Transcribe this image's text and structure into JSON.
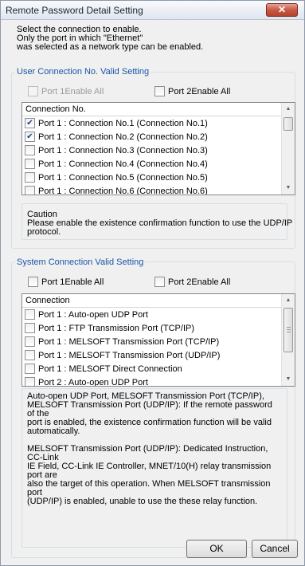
{
  "window": {
    "title": "Remote Password Detail Setting",
    "close_icon": "close-icon"
  },
  "intro": {
    "line1": "Select the connection to enable.",
    "line2": "Only the port in which \"Ethernet\"",
    "line3": "was selected as a network type can be enabled."
  },
  "user_group": {
    "legend": "User Connection No. Valid Setting",
    "port1_enable_all": "Port 1Enable All",
    "port1_enable_all_checked": false,
    "port1_enable_all_enabled": false,
    "port2_enable_all": "Port 2Enable All",
    "port2_enable_all_checked": false,
    "list_header": "Connection No.",
    "rows": [
      {
        "label": "Port 1 : Connection No.1 (Connection No.1)",
        "checked": true
      },
      {
        "label": "Port 1 : Connection No.2 (Connection No.2)",
        "checked": true
      },
      {
        "label": "Port 1 : Connection No.3 (Connection No.3)",
        "checked": false
      },
      {
        "label": "Port 1 : Connection No.4 (Connection No.4)",
        "checked": false
      },
      {
        "label": "Port 1 : Connection No.5 (Connection No.5)",
        "checked": false
      },
      {
        "label": "Port 1 : Connection No.6 (Connection No.6)",
        "checked": false
      }
    ],
    "caution_title": "Caution",
    "caution_line1": "Please enable the existence confirmation function to use the UDP/IP",
    "caution_line2": "protocol."
  },
  "system_group": {
    "legend": "System Connection Valid Setting",
    "port1_enable_all": "Port 1Enable All",
    "port1_enable_all_checked": false,
    "port2_enable_all": "Port 2Enable All",
    "port2_enable_all_checked": false,
    "list_header": "Connection",
    "rows": [
      {
        "label": "Port 1 : Auto-open UDP Port",
        "checked": false
      },
      {
        "label": "Port 1 : FTP Transmission Port (TCP/IP)",
        "checked": false
      },
      {
        "label": "Port 1 : MELSOFT Transmission Port (TCP/IP)",
        "checked": false
      },
      {
        "label": "Port 1 : MELSOFT Transmission Port (UDP/IP)",
        "checked": false
      },
      {
        "label": "Port 1 : MELSOFT Direct Connection",
        "checked": false
      },
      {
        "label": "Port 2 : Auto-open UDP Port",
        "checked": false
      }
    ]
  },
  "description": {
    "para1": [
      "Auto-open UDP Port, MELSOFT Transmission Port (TCP/IP),",
      "MELSOFT Transmission Port (UDP/IP): If the remote password of the",
      "port is enabled, the existence confirmation function will be valid",
      "automatically."
    ],
    "para2": [
      "MELSOFT Transmission Port (UDP/IP): Dedicated Instruction, CC-Link",
      "IE Field, CC-Link IE Controller, MNET/10(H) relay transmission port are",
      "also the target of this operation. When MELSOFT transmission port",
      "(UDP/IP) is enabled, unable to use the these relay function."
    ]
  },
  "buttons": {
    "ok": "OK",
    "cancel": "Cancel"
  }
}
